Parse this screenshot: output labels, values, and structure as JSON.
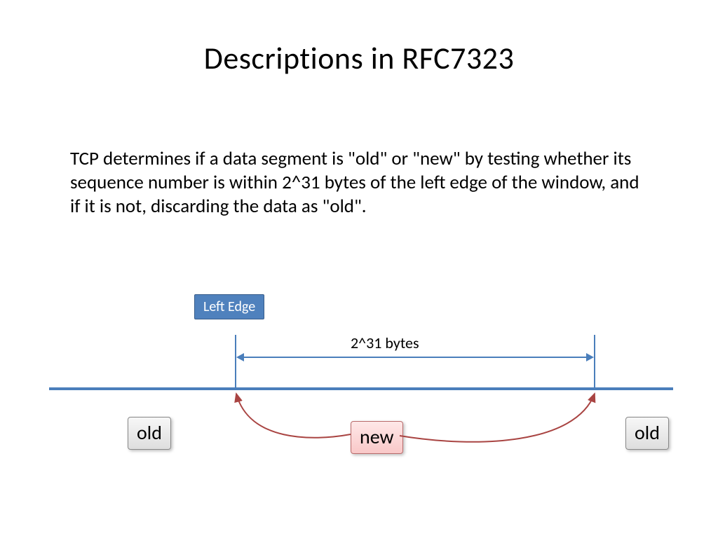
{
  "title": "Descriptions in RFC7323",
  "body": "TCP determines if a data segment is \"old\" or \"new\" by testing whether its sequence number is within 2^31 bytes of the left edge of the window, and if it is not, discarding the data as \"old\".",
  "diagram": {
    "left_edge_label": "Left Edge",
    "range_label": "2^31 bytes",
    "old_label": "old",
    "new_label": "new"
  }
}
